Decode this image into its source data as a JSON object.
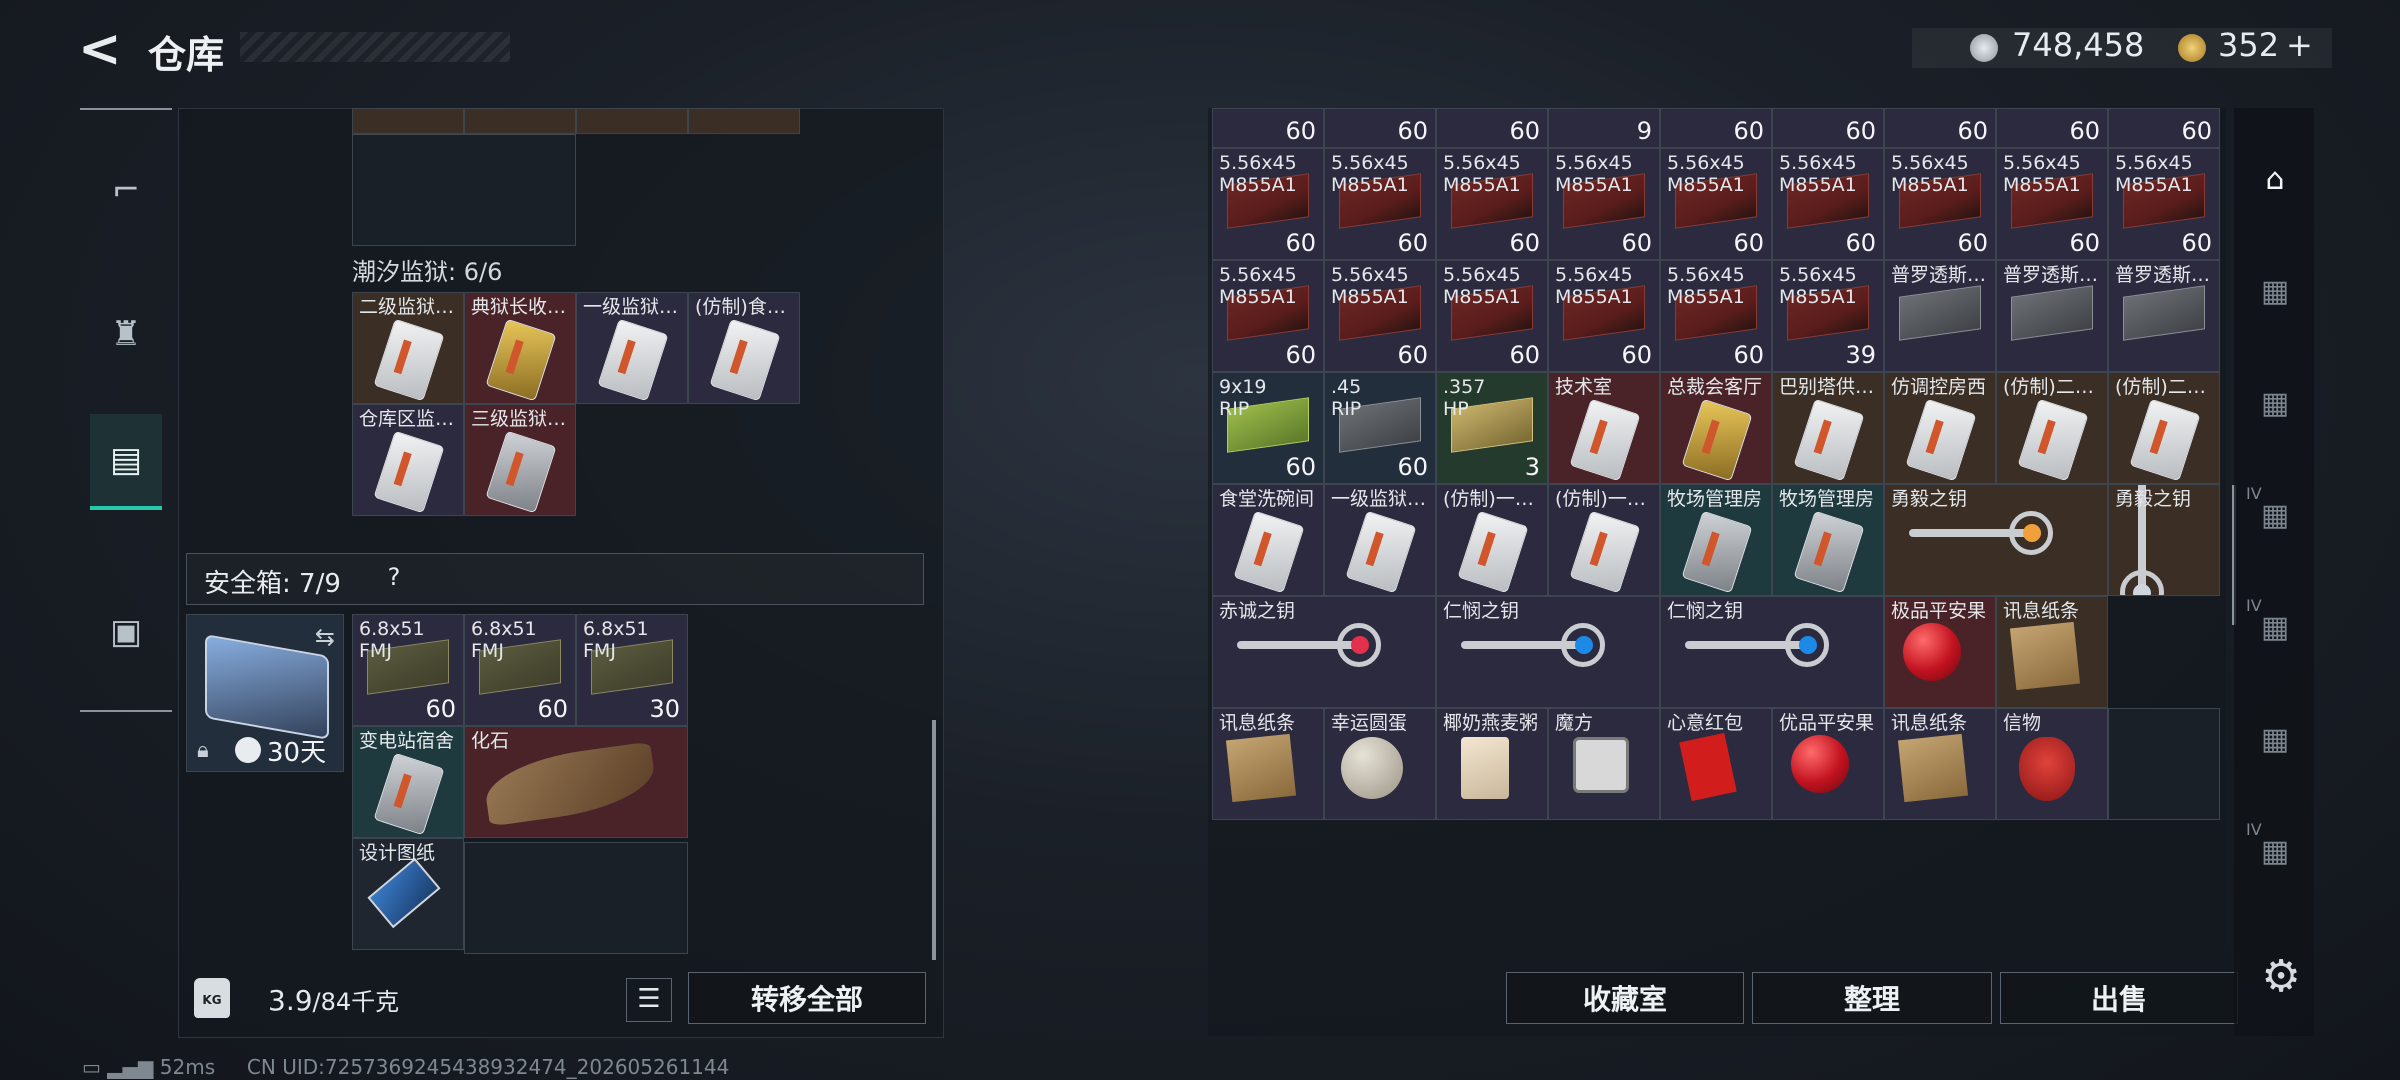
{
  "header": {
    "title": "仓库",
    "currency1_value": "748,458",
    "currency2_value": "352",
    "currency2_add": "+",
    "currency1_icon": "coin-icon",
    "currency2_icon": "bond-icon"
  },
  "nav": [
    {
      "icon": "gun-icon",
      "glyph": "⌐"
    },
    {
      "icon": "armor-icon",
      "glyph": "♜"
    },
    {
      "icon": "backpack-icon",
      "glyph": "▤",
      "active": true
    },
    {
      "icon": "briefcase-icon",
      "glyph": "▣"
    }
  ],
  "left": {
    "section1_label": "潮汐监狱: 6/6",
    "section1_items": [
      {
        "label": "二级监狱…",
        "art": "card",
        "bg": "c-brown"
      },
      {
        "label": "典狱长收…",
        "art": "card-gold",
        "bg": "c-red"
      },
      {
        "label": "一级监狱…",
        "art": "card",
        "bg": "c-purple"
      },
      {
        "label": "(仿制)食…",
        "art": "card",
        "bg": "c-purple"
      },
      {
        "label": "仓库区监…",
        "art": "card",
        "bg": "c-purple"
      },
      {
        "label": "三级监狱…",
        "art": "card-dark",
        "bg": "c-red"
      }
    ],
    "safebox_label": "安全箱: 7/9",
    "safebox_help": "?",
    "safebox_days": "30天",
    "safebox_items": [
      {
        "label": "6.8x51\nFMJ",
        "count": "60",
        "art": "ammo-tan",
        "bg": "c-purple"
      },
      {
        "label": "6.8x51\nFMJ",
        "count": "60",
        "art": "ammo-tan",
        "bg": "c-purple"
      },
      {
        "label": "6.8x51\nFMJ",
        "count": "30",
        "art": "ammo-tan",
        "bg": "c-purple"
      },
      {
        "label": "变电站宿舍",
        "art": "card-dark",
        "bg": "c-teal"
      },
      {
        "label": "化石",
        "art": "bone",
        "bg": "c-red"
      },
      {
        "label": "设计图纸",
        "art": "drive",
        "bg": "c-dark"
      }
    ],
    "weight_current": "3.9",
    "weight_max": "/84千克",
    "transfer_all": "转移全部"
  },
  "right": {
    "row0_counts": [
      "60",
      "60",
      "60",
      "9",
      "60",
      "60",
      "60",
      "60",
      "60"
    ],
    "rows": [
      [
        {
          "label": "5.56x45\nM855A1",
          "count": "60",
          "art": "ammo",
          "bg": "c-purple"
        },
        {
          "label": "5.56x45\nM855A1",
          "count": "60",
          "art": "ammo",
          "bg": "c-purple"
        },
        {
          "label": "5.56x45\nM855A1",
          "count": "60",
          "art": "ammo",
          "bg": "c-purple"
        },
        {
          "label": "5.56x45\nM855A1",
          "count": "60",
          "art": "ammo",
          "bg": "c-purple"
        },
        {
          "label": "5.56x45\nM855A1",
          "count": "60",
          "art": "ammo",
          "bg": "c-purple"
        },
        {
          "label": "5.56x45\nM855A1",
          "count": "60",
          "art": "ammo",
          "bg": "c-purple"
        },
        {
          "label": "5.56x45\nM855A1",
          "count": "60",
          "art": "ammo",
          "bg": "c-purple"
        },
        {
          "label": "5.56x45\nM855A1",
          "count": "60",
          "art": "ammo",
          "bg": "c-purple"
        },
        {
          "label": "5.56x45\nM855A1",
          "count": "60",
          "art": "ammo",
          "bg": "c-purple"
        }
      ],
      [
        {
          "label": "5.56x45\nM855A1",
          "count": "60",
          "art": "ammo",
          "bg": "c-purple"
        },
        {
          "label": "5.56x45\nM855A1",
          "count": "60",
          "art": "ammo",
          "bg": "c-purple"
        },
        {
          "label": "5.56x45\nM855A1",
          "count": "60",
          "art": "ammo",
          "bg": "c-purple"
        },
        {
          "label": "5.56x45\nM855A1",
          "count": "60",
          "art": "ammo",
          "bg": "c-purple"
        },
        {
          "label": "5.56x45\nM855A1",
          "count": "60",
          "art": "ammo",
          "bg": "c-purple"
        },
        {
          "label": "5.56x45\nM855A1",
          "count": "39",
          "art": "ammo",
          "bg": "c-purple"
        },
        {
          "label": "普罗透斯…",
          "art": "ammo-grey",
          "bg": "c-purple"
        },
        {
          "label": "普罗透斯…",
          "art": "ammo-grey",
          "bg": "c-purple"
        },
        {
          "label": "普罗透斯…",
          "art": "ammo-grey",
          "bg": "c-purple"
        }
      ],
      [
        {
          "label": "9x19\nRIP",
          "count": "60",
          "art": "ammo-green",
          "bg": "c-blue"
        },
        {
          "label": ".45\nRIP",
          "count": "60",
          "art": "ammo-grey",
          "bg": "c-blue"
        },
        {
          "label": ".357\nHP",
          "count": "3",
          "art": "ammo-yellow",
          "bg": "c-green"
        },
        {
          "label": "技术室",
          "art": "card",
          "bg": "c-red"
        },
        {
          "label": "总裁会客厅",
          "art": "card-gold",
          "bg": "c-red"
        },
        {
          "label": "巴别塔供…",
          "art": "card",
          "bg": "c-brown"
        },
        {
          "label": "仿调控房西",
          "art": "card",
          "bg": "c-brown"
        },
        {
          "label": "(仿制)二…",
          "art": "card",
          "bg": "c-brown"
        },
        {
          "label": "(仿制)二…",
          "art": "card",
          "bg": "c-brown"
        }
      ],
      [
        {
          "label": "食堂洗碗间",
          "art": "card",
          "bg": "c-purple"
        },
        {
          "label": "一级监狱…",
          "art": "card",
          "bg": "c-purple"
        },
        {
          "label": "(仿制)一…",
          "art": "card",
          "bg": "c-purple"
        },
        {
          "label": "(仿制)一…",
          "art": "card",
          "bg": "c-purple"
        },
        {
          "label": "牧场管理房",
          "art": "card-dark",
          "bg": "c-teal"
        },
        {
          "label": "牧场管理房",
          "art": "card-dark",
          "bg": "c-teal"
        },
        {
          "label": "勇毅之钥",
          "art": "key-gold",
          "bg": "c-brown",
          "span": 2
        },
        {
          "label": "勇毅之钥",
          "art": "key-vertical",
          "bg": "c-brown"
        }
      ],
      [
        {
          "label": "赤诚之钥",
          "art": "key-red",
          "bg": "c-purple",
          "span": 2
        },
        {
          "label": "仁悯之钥",
          "art": "key-blue",
          "bg": "c-purple",
          "span": 2
        },
        {
          "label": "仁悯之钥",
          "art": "key-blue",
          "bg": "c-purple",
          "span": 2
        },
        {
          "label": "极品平安果",
          "art": "apple",
          "bg": "c-red"
        },
        {
          "label": "讯息纸条",
          "art": "paper",
          "bg": "c-brown"
        }
      ],
      [
        {
          "label": "讯息纸条",
          "art": "paper",
          "bg": "c-purple"
        },
        {
          "label": "幸运圆蛋",
          "art": "ball",
          "bg": "c-purple"
        },
        {
          "label": "椰奶燕麦粥",
          "art": "bag",
          "bg": "c-purple"
        },
        {
          "label": "魔方",
          "art": "cube",
          "bg": "c-purple"
        },
        {
          "label": "心意红包",
          "art": "envelope",
          "bg": "c-purple"
        },
        {
          "label": "优品平安果",
          "art": "apple",
          "bg": "c-purple"
        },
        {
          "label": "讯息纸条",
          "art": "paper",
          "bg": "c-purple"
        },
        {
          "label": "信物",
          "art": "mask",
          "bg": "c-purple"
        },
        {
          "label": "",
          "art": "",
          "bg": "c-empty"
        }
      ]
    ],
    "buttons": {
      "collection": "收藏室",
      "sort": "整理",
      "sell": "出售"
    },
    "side_tabs": [
      "storage-icon",
      "warehouse-2-icon",
      "warehouse-3-icon",
      "warehouse-4-icon",
      "warehouse-5-icon",
      "warehouse-6-icon",
      "warehouse-7-icon"
    ],
    "side_tab_labels": [
      "",
      "",
      "",
      "IV",
      "IV",
      "",
      "IV"
    ]
  },
  "footer": {
    "ping": "52ms",
    "uid": "CN UID:725736924543893247​4_202605261144"
  },
  "colors": {
    "accent": "#27c9a8",
    "ammo_red": "#6b2523",
    "card_white": "#f1f2f3"
  }
}
